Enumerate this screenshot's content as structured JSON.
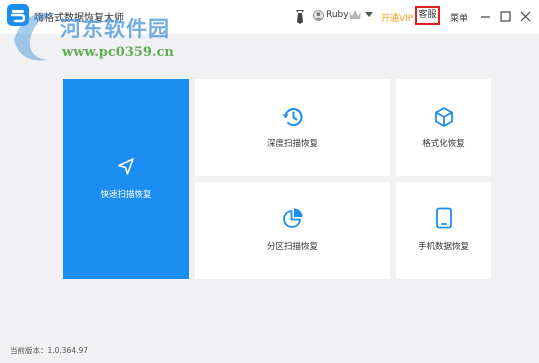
{
  "window": {
    "title": "嗨格式数据恢复大师"
  },
  "watermark": {
    "main": "河东软件园",
    "url": "www.pc0359.cn"
  },
  "user": {
    "name": "Ruby"
  },
  "header": {
    "vip_label": "开通VIP",
    "service_label": "客服",
    "menu_label": "菜单"
  },
  "cards": {
    "quick_scan": "快速扫描恢复",
    "deep_scan": "深度扫描恢复",
    "format_recover": "格式化恢复",
    "partition_scan": "分区扫描恢复",
    "phone_recover": "手机数据恢复"
  },
  "footer": {
    "version_label": "当前版本：",
    "version": "1.0.364.97"
  },
  "colors": {
    "accent": "#1d8ef1",
    "vip": "#f4a11c",
    "highlight_border": "#e02020",
    "background": "#f1f1f3"
  },
  "icons": {
    "quick_scan": "navigation-arrow-icon",
    "deep_scan": "history-clock-icon",
    "format_recover": "cube-icon",
    "partition_scan": "pie-chart-icon",
    "phone_recover": "tablet-icon"
  }
}
